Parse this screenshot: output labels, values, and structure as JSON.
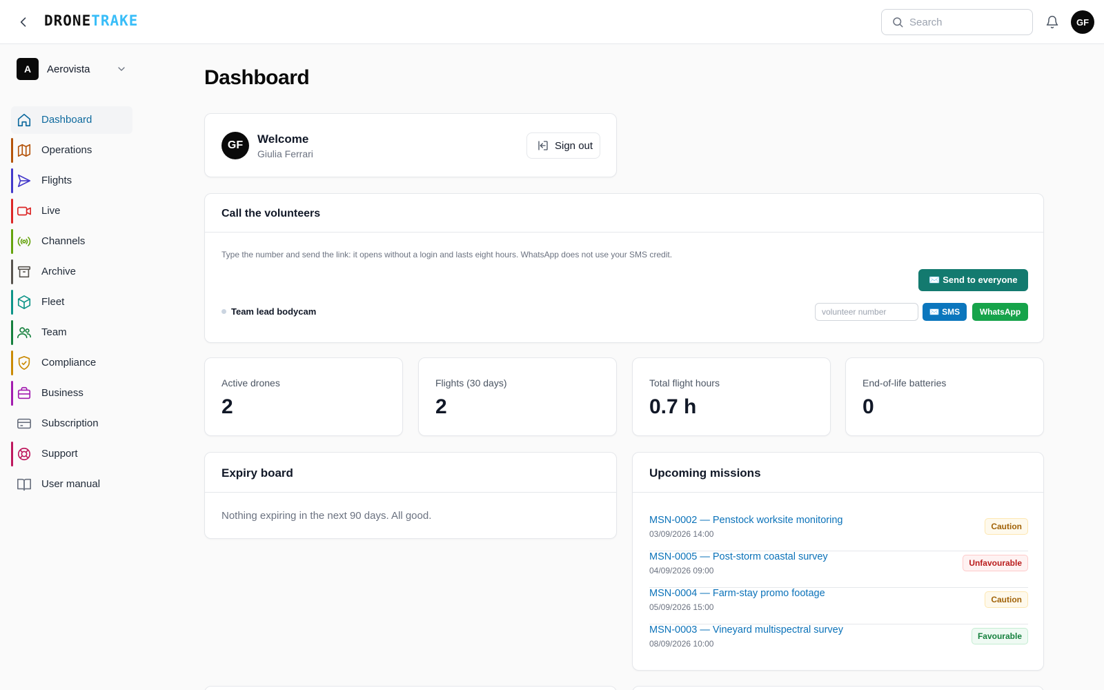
{
  "app": {
    "logo_part1": "DRONE",
    "logo_part2": "TRAKE",
    "accent": "#38bdf8"
  },
  "header": {
    "search_placeholder": "Search",
    "avatar_initials": "GF"
  },
  "org": {
    "initial": "A",
    "name": "Aerovista"
  },
  "sidebar": {
    "items": [
      {
        "label": "Dashboard",
        "icon": "home-icon",
        "color": "#0e6a9e",
        "active": true
      },
      {
        "label": "Operations",
        "icon": "map-icon",
        "color": "#b45309"
      },
      {
        "label": "Flights",
        "icon": "send-icon",
        "color": "#4338ca"
      },
      {
        "label": "Live",
        "icon": "video-icon",
        "color": "#dc2626"
      },
      {
        "label": "Channels",
        "icon": "broadcast-icon",
        "color": "#65a30d"
      },
      {
        "label": "Archive",
        "icon": "archive-icon",
        "color": "#57534e"
      },
      {
        "label": "Fleet",
        "icon": "box-icon",
        "color": "#0d9488"
      },
      {
        "label": "Team",
        "icon": "users-icon",
        "color": "#15803d"
      },
      {
        "label": "Compliance",
        "icon": "shield-check-icon",
        "color": "#ca8a04"
      },
      {
        "label": "Business",
        "icon": "briefcase-icon",
        "color": "#a21caf"
      },
      {
        "label": "Subscription",
        "icon": "credit-card-icon",
        "color": "#6b7280"
      },
      {
        "label": "Support",
        "icon": "life-buoy-icon",
        "color": "#be185d"
      },
      {
        "label": "User manual",
        "icon": "book-icon",
        "color": "#6b7280"
      }
    ]
  },
  "main": {
    "title": "Dashboard",
    "welcome": {
      "avatar_initials": "GF",
      "title": "Welcome",
      "name": "Giulia Ferrari",
      "signout_label": "Sign out"
    },
    "volunteers": {
      "title": "Call the volunteers",
      "description": "Type the number and send the link: it opens without a login and lasts eight hours. WhatsApp does not use your SMS credit.",
      "send_all_label": "✉️ Send to everyone",
      "row_label": "Team lead bodycam",
      "input_placeholder": "volunteer number",
      "sms_label": "✉️ SMS",
      "whatsapp_label": "WhatsApp"
    },
    "stats": [
      {
        "label": "Active drones",
        "value": "2"
      },
      {
        "label": "Flights (30 days)",
        "value": "2"
      },
      {
        "label": "Total flight hours",
        "value": "0.7 h"
      },
      {
        "label": "End-of-life batteries",
        "value": "0"
      }
    ],
    "expiry": {
      "title": "Expiry board",
      "text": "Nothing expiring in the next 90 days. All good."
    },
    "missions": {
      "title": "Upcoming missions",
      "items": [
        {
          "title": "MSN-0002 — Penstock worksite monitoring",
          "date": "03/09/2026 14:00",
          "badge": "Caution"
        },
        {
          "title": "MSN-0005 — Post-storm coastal survey",
          "date": "04/09/2026 09:00",
          "badge": "Unfavourable"
        },
        {
          "title": "MSN-0004 — Farm-stay promo footage",
          "date": "05/09/2026 15:00",
          "badge": "Caution"
        },
        {
          "title": "MSN-0003 — Vineyard multispectral survey",
          "date": "08/09/2026 10:00",
          "badge": "Favourable"
        }
      ]
    }
  }
}
